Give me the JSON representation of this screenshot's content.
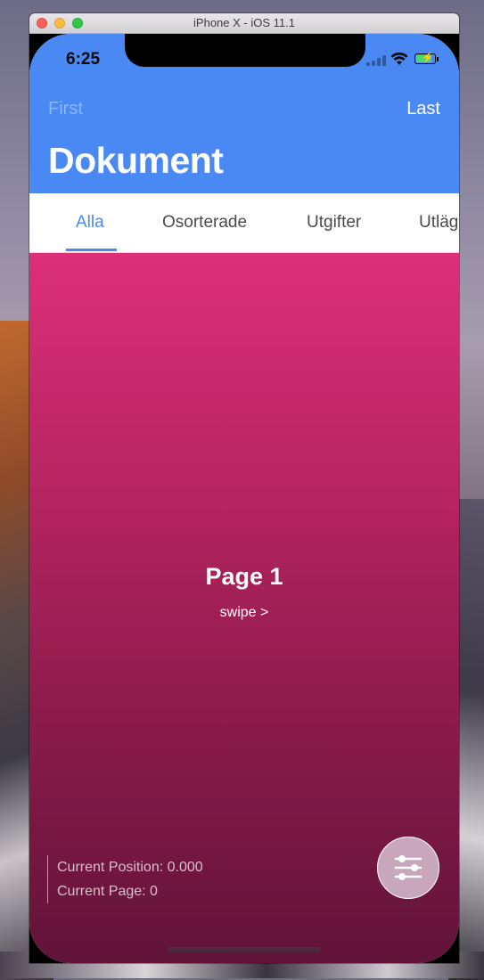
{
  "window": {
    "title": "iPhone X - iOS 11.1"
  },
  "status_bar": {
    "time": "6:25",
    "signal_icon": "signal-bars-icon",
    "wifi_icon": "wifi-icon",
    "battery_icon": "battery-charging-icon"
  },
  "navbar": {
    "first_label": "First",
    "last_label": "Last",
    "title": "Dokument"
  },
  "tabs": [
    {
      "label": "Alla",
      "active": true
    },
    {
      "label": "Osorterade",
      "active": false
    },
    {
      "label": "Utgifter",
      "active": false
    },
    {
      "label": "Utlägg",
      "active": false
    }
  ],
  "page": {
    "heading": "Page 1",
    "hint": "swipe >"
  },
  "info": {
    "position": "Current Position: 0.000",
    "page": "Current Page: 0"
  },
  "fab": {
    "icon": "sliders-icon"
  },
  "colors": {
    "primary": "#4a89f3",
    "page_top": "#dc2f7a",
    "page_bottom": "#611438"
  }
}
